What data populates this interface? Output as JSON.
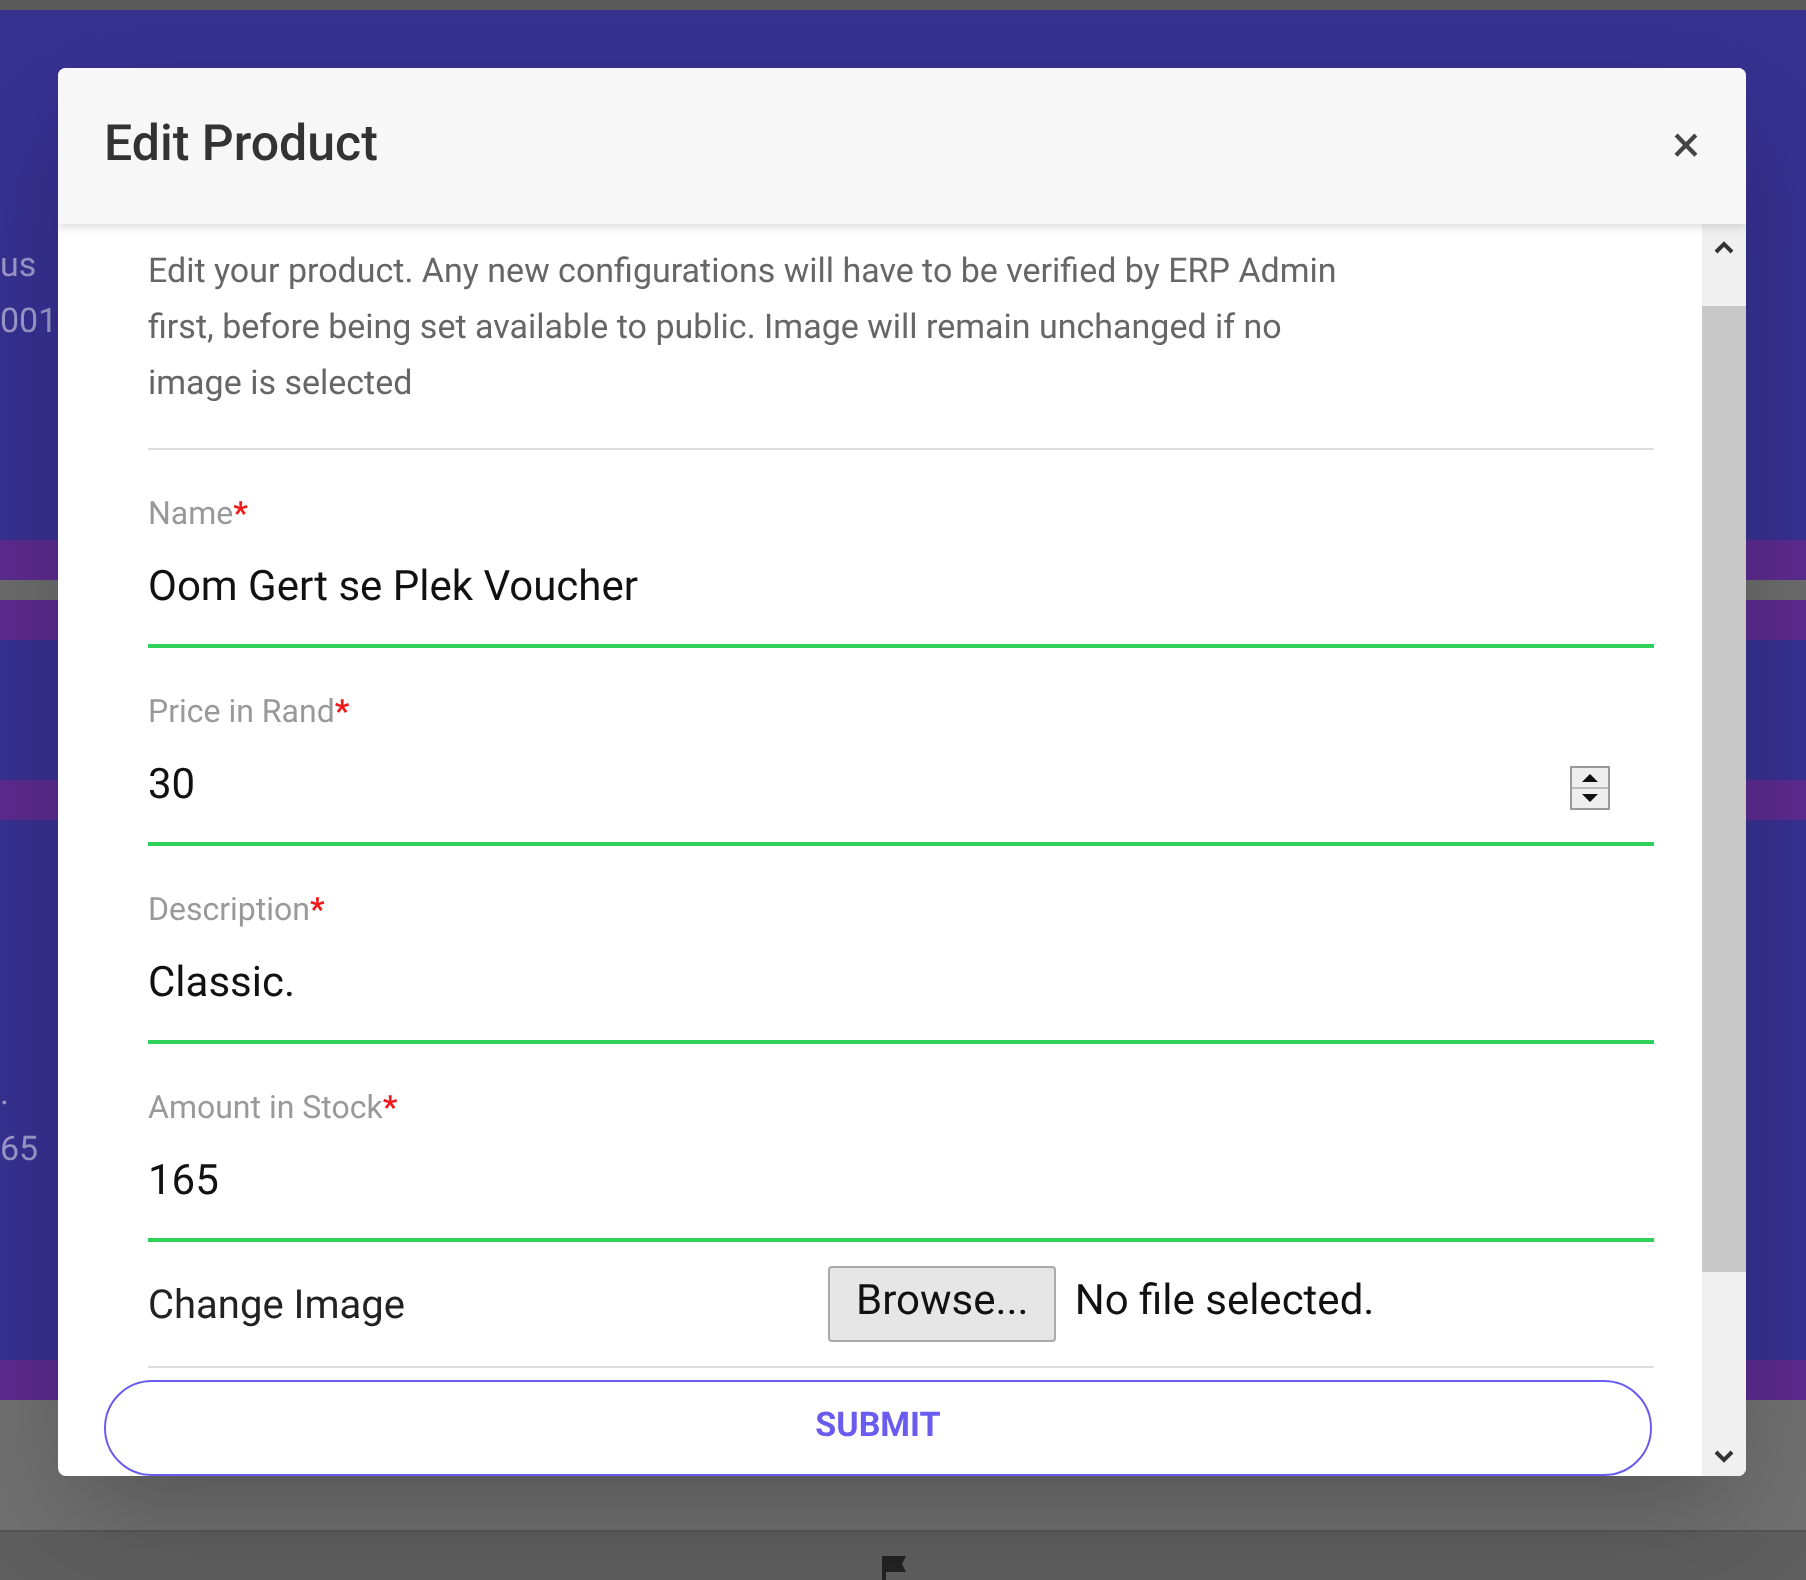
{
  "background": {
    "texts": [
      "us",
      "001",
      ".",
      "65"
    ]
  },
  "modal": {
    "title": "Edit Product",
    "close": "×",
    "intro": "Edit your product. Any new configurations will have to be verified by ERP Admin first, before being set available to public. Image will remain unchanged if no image is selected",
    "fields": [
      {
        "kind": "text",
        "label": "Name",
        "mark": "*",
        "value": "Oom Gert se Plek Voucher"
      },
      {
        "kind": "number",
        "label": "Price in Rand",
        "mark": "*",
        "value": "30"
      },
      {
        "kind": "text",
        "label": "Description",
        "mark": "*",
        "value": "Classic."
      },
      {
        "kind": "text",
        "label": "Amount in Stock",
        "mark": "*",
        "value": "165"
      }
    ],
    "image": {
      "label": "Change Image",
      "button": "Browse...",
      "status": "No file selected."
    },
    "submit": "SUBMIT"
  }
}
